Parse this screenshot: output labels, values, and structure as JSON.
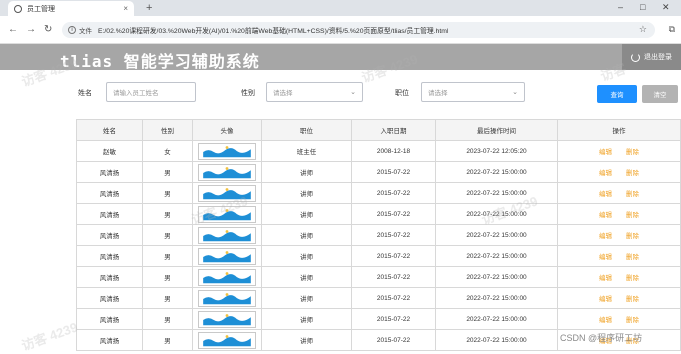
{
  "browser": {
    "tab_title": "员工管理",
    "tab_close": "×",
    "new_tab": "+",
    "window_controls": [
      "–",
      "□",
      "✕"
    ],
    "nav": [
      "←",
      "→",
      "↻"
    ],
    "file_label": "文件",
    "url": "E:/02.%20课程研发/03.%20Web开发(AI)/01.%20前端Web基础(HTML+CSS)/资料/5.%20页面原型/tlias/员工管理.html",
    "icons": [
      "info-icon",
      "star-icon",
      "extension-icon"
    ]
  },
  "header": {
    "title": "tlias 智能学习辅助系统",
    "logout_label": "退出登录"
  },
  "search": {
    "name_label": "姓名",
    "name_placeholder": "请输入员工姓名",
    "gender_label": "性别",
    "gender_placeholder": "请选择",
    "position_label": "职位",
    "position_placeholder": "请选择",
    "search_button": "查询",
    "clear_button": "清空"
  },
  "table": {
    "columns": [
      "姓名",
      "性别",
      "头像",
      "职位",
      "入职日期",
      "最后操作时间",
      "操作"
    ],
    "edit_label": "编辑",
    "delete_label": "删除",
    "rows": [
      {
        "name": "赵敏",
        "gender": "女",
        "position": "班主任",
        "entry_date": "2008-12-18",
        "last_op": "2023-07-22 12:05:20"
      },
      {
        "name": "风清扬",
        "gender": "男",
        "position": "讲师",
        "entry_date": "2015-07-22",
        "last_op": "2022-07-22 15:00:00"
      },
      {
        "name": "风清扬",
        "gender": "男",
        "position": "讲师",
        "entry_date": "2015-07-22",
        "last_op": "2022-07-22 15:00:00"
      },
      {
        "name": "风清扬",
        "gender": "男",
        "position": "讲师",
        "entry_date": "2015-07-22",
        "last_op": "2022-07-22 15:00:00"
      },
      {
        "name": "风清扬",
        "gender": "男",
        "position": "讲师",
        "entry_date": "2015-07-22",
        "last_op": "2022-07-22 15:00:00"
      },
      {
        "name": "风清扬",
        "gender": "男",
        "position": "讲师",
        "entry_date": "2015-07-22",
        "last_op": "2022-07-22 15:00:00"
      },
      {
        "name": "风清扬",
        "gender": "男",
        "position": "讲师",
        "entry_date": "2015-07-22",
        "last_op": "2022-07-22 15:00:00"
      },
      {
        "name": "风清扬",
        "gender": "男",
        "position": "讲师",
        "entry_date": "2015-07-22",
        "last_op": "2022-07-22 15:00:00"
      },
      {
        "name": "风清扬",
        "gender": "男",
        "position": "讲师",
        "entry_date": "2015-07-22",
        "last_op": "2022-07-22 15:00:00"
      },
      {
        "name": "风清扬",
        "gender": "男",
        "position": "讲师",
        "entry_date": "2015-07-22",
        "last_op": "2022-07-22 15:00:00"
      }
    ]
  },
  "watermark_text": "CSDN @程序研工坊",
  "colors": {
    "header_bg": "#a6a6a6",
    "primary": "#1e90ff",
    "action": "#f0a020"
  }
}
